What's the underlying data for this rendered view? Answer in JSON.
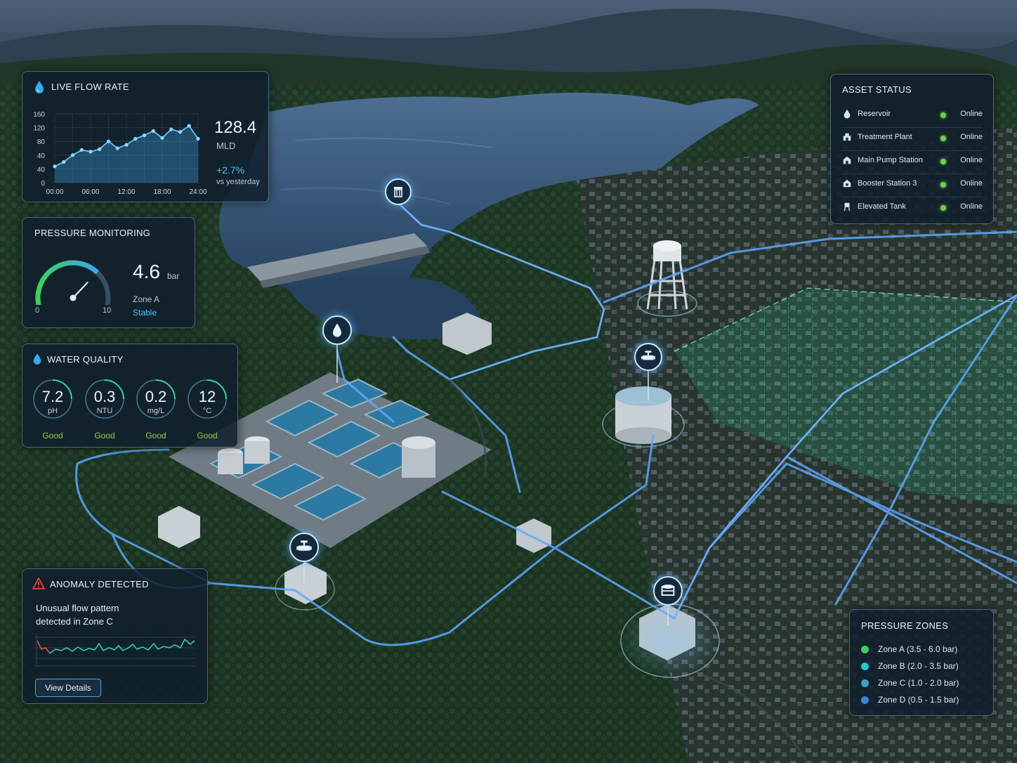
{
  "flow": {
    "title": "LIVE FLOW RATE",
    "value": "128.4",
    "unit": "MLD",
    "change": "+2.7%",
    "change_note": "vs yesterday",
    "y_ticks": [
      "160",
      "120",
      "80",
      "40",
      "40",
      "0"
    ],
    "x_ticks": [
      "00:00",
      "06:00",
      "12:00",
      "18:00",
      "24:00"
    ]
  },
  "chart_data": {
    "type": "area",
    "title": "LIVE FLOW RATE",
    "x": [
      "00:00",
      "01:30",
      "03:00",
      "04:30",
      "06:00",
      "07:30",
      "09:00",
      "10:30",
      "12:00",
      "13:30",
      "15:00",
      "16:30",
      "18:00",
      "19:30",
      "21:00",
      "22:30",
      "24:00"
    ],
    "values": [
      38,
      48,
      64,
      76,
      72,
      78,
      96,
      80,
      88,
      102,
      110,
      120,
      104,
      124,
      118,
      132,
      102
    ],
    "ylim": [
      0,
      160
    ],
    "grid": true
  },
  "pressure": {
    "title": "PRESSURE MONITORING",
    "value": "4.6",
    "unit": "bar",
    "zone": "Zone A",
    "state": "Stable",
    "gauge_min": "0",
    "gauge_max": "10",
    "gauge_level": 4.6
  },
  "quality": {
    "title": "WATER QUALITY",
    "metrics": [
      {
        "value": "7.2",
        "unit": "pH",
        "status": "Good"
      },
      {
        "value": "0.3",
        "unit": "NTU",
        "status": "Good"
      },
      {
        "value": "0.2",
        "unit": "mg/L",
        "status": "Good"
      },
      {
        "value": "12",
        "unit": "°C",
        "status": "Good"
      }
    ]
  },
  "anomaly": {
    "title": "ANOMALY DETECTED",
    "line1": "Unusual flow pattern",
    "line2": "detected in Zone C",
    "button": "View Details"
  },
  "assets": {
    "title": "ASSET STATUS",
    "items": [
      {
        "name": "Reservoir",
        "status": "Online",
        "icon": "droplet-icon"
      },
      {
        "name": "Treatment Plant",
        "status": "Online",
        "icon": "plant-icon"
      },
      {
        "name": "Main Pump Station",
        "status": "Online",
        "icon": "pump-icon"
      },
      {
        "name": "Booster Station 3",
        "status": "Online",
        "icon": "booster-icon"
      },
      {
        "name": "Elevated Tank",
        "status": "Online",
        "icon": "tank-icon"
      }
    ]
  },
  "zones": {
    "title": "PRESSURE ZONES",
    "items": [
      {
        "label": "Zone A (3.5 - 6.0 bar)",
        "color": "#3ecf5f"
      },
      {
        "label": "Zone B (2.0 - 3.5 bar)",
        "color": "#22c4d6"
      },
      {
        "label": "Zone C (1.0 - 2.0 bar)",
        "color": "#3aa0c8"
      },
      {
        "label": "Zone D (0.5 - 1.5 bar)",
        "color": "#3a86d8"
      }
    ]
  },
  "colors": {
    "accent": "#4fc3f7",
    "good": "#8fd14f",
    "online": "#6fd14a",
    "alert": "#e5483c"
  }
}
